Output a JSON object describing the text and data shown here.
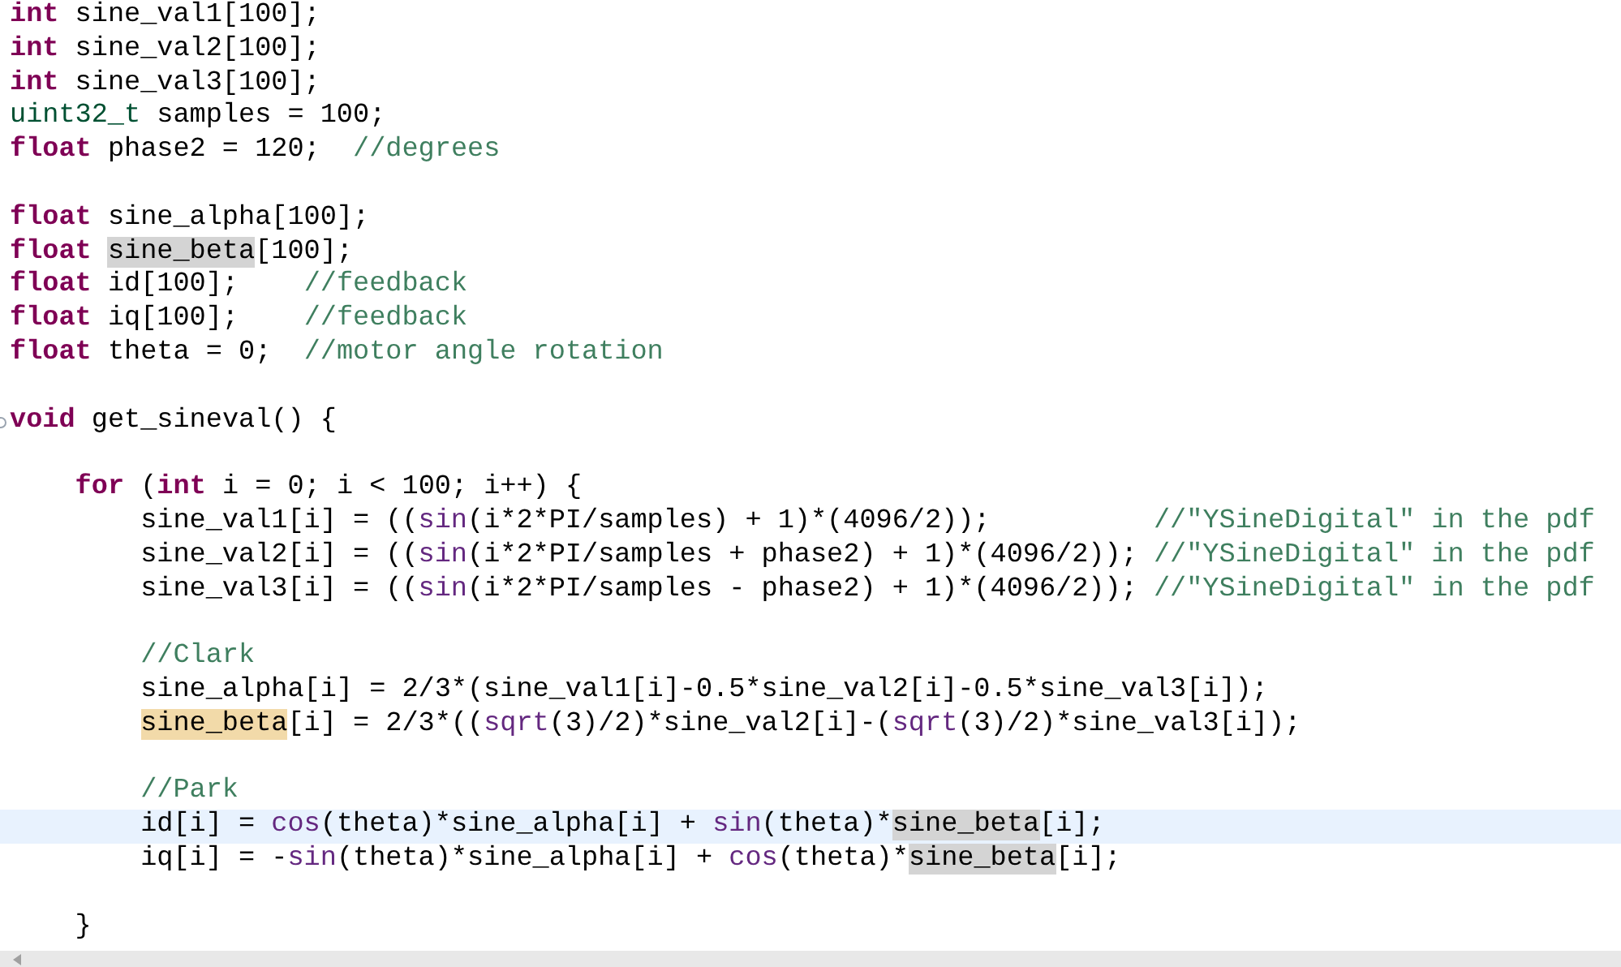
{
  "editor": {
    "lines": [
      {
        "kind": "code",
        "current": false,
        "tokens": [
          {
            "kind": "keyword",
            "text": "int"
          },
          {
            "kind": "plain",
            "text": " sine_val1[100];"
          }
        ]
      },
      {
        "kind": "code",
        "current": false,
        "tokens": [
          {
            "kind": "keyword",
            "text": "int"
          },
          {
            "kind": "plain",
            "text": " sine_val2[100];"
          }
        ]
      },
      {
        "kind": "code",
        "current": false,
        "tokens": [
          {
            "kind": "keyword",
            "text": "int"
          },
          {
            "kind": "plain",
            "text": " sine_val3[100];"
          }
        ]
      },
      {
        "kind": "code",
        "current": false,
        "tokens": [
          {
            "kind": "type",
            "text": "uint32_t"
          },
          {
            "kind": "plain",
            "text": " samples = 100;"
          }
        ]
      },
      {
        "kind": "code",
        "current": false,
        "tokens": [
          {
            "kind": "keyword",
            "text": "float"
          },
          {
            "kind": "plain",
            "text": " phase2 = 120;  "
          },
          {
            "kind": "comment",
            "text": "//degrees"
          }
        ]
      },
      {
        "kind": "blank",
        "current": false
      },
      {
        "kind": "code",
        "current": false,
        "tokens": [
          {
            "kind": "keyword",
            "text": "float"
          },
          {
            "kind": "plain",
            "text": " sine_alpha[100];"
          }
        ]
      },
      {
        "kind": "code",
        "current": false,
        "tokens": [
          {
            "kind": "keyword",
            "text": "float"
          },
          {
            "kind": "occurrence",
            "text": " sine_beta"
          },
          {
            "kind": "plain",
            "text": "[100];"
          }
        ]
      },
      {
        "kind": "code",
        "current": false,
        "tokens": [
          {
            "kind": "keyword",
            "text": "float"
          },
          {
            "kind": "plain",
            "text": " id[100];    "
          },
          {
            "kind": "comment",
            "text": "//feedback"
          }
        ]
      },
      {
        "kind": "code",
        "current": false,
        "tokens": [
          {
            "kind": "keyword",
            "text": "float"
          },
          {
            "kind": "plain",
            "text": " iq[100];    "
          },
          {
            "kind": "comment",
            "text": "//feedback"
          }
        ]
      },
      {
        "kind": "code",
        "current": false,
        "tokens": [
          {
            "kind": "keyword",
            "text": "float"
          },
          {
            "kind": "plain",
            "text": " theta = 0;  "
          },
          {
            "kind": "comment",
            "text": "//motor angle rotation"
          }
        ]
      },
      {
        "kind": "blank",
        "current": false
      },
      {
        "kind": "code",
        "current": false,
        "foldable": true,
        "tokens": [
          {
            "kind": "keyword",
            "text": "void"
          },
          {
            "kind": "plain",
            "text": " get_sineval() {"
          }
        ]
      },
      {
        "kind": "blank",
        "current": false
      },
      {
        "kind": "code",
        "current": false,
        "tokens": [
          {
            "kind": "keyword",
            "text": "    for"
          },
          {
            "kind": "plain",
            "text": " ("
          },
          {
            "kind": "keyword",
            "text": "int"
          },
          {
            "kind": "plain",
            "text": " i = 0; i < 100; i++) {"
          }
        ]
      },
      {
        "kind": "code",
        "current": false,
        "tokens": [
          {
            "kind": "plain",
            "text": "        sine_val1[i] = (("
          },
          {
            "kind": "function",
            "text": "sin"
          },
          {
            "kind": "plain",
            "text": "(i*2*PI/samples) + 1)*(4096/2));          "
          },
          {
            "kind": "comment",
            "text": "//\"YSineDigital\" in the pdf"
          }
        ]
      },
      {
        "kind": "code",
        "current": false,
        "tokens": [
          {
            "kind": "plain",
            "text": "        sine_val2[i] = (("
          },
          {
            "kind": "function",
            "text": "sin"
          },
          {
            "kind": "plain",
            "text": "(i*2*PI/samples + phase2) + 1)*(4096/2)); "
          },
          {
            "kind": "comment",
            "text": "//\"YSineDigital\" in the pdf"
          }
        ]
      },
      {
        "kind": "code",
        "current": false,
        "tokens": [
          {
            "kind": "plain",
            "text": "        sine_val3[i] = (("
          },
          {
            "kind": "function",
            "text": "sin"
          },
          {
            "kind": "plain",
            "text": "(i*2*PI/samples - phase2) + 1)*(4096/2)); "
          },
          {
            "kind": "comment",
            "text": "//\"YSineDigital\" in the pdf"
          }
        ]
      },
      {
        "kind": "blank",
        "current": false
      },
      {
        "kind": "code",
        "current": false,
        "tokens": [
          {
            "kind": "comment",
            "text": "        //Clark"
          }
        ]
      },
      {
        "kind": "code",
        "current": false,
        "tokens": [
          {
            "kind": "plain",
            "text": "        sine_alpha[i] = 2/3*(sine_val1[i]-0.5*sine_val2[i]-0.5*sine_val3[i]);"
          }
        ]
      },
      {
        "kind": "code",
        "current": false,
        "tokens": [
          {
            "kind": "write-occurrence",
            "text": "        sine_beta"
          },
          {
            "kind": "plain",
            "text": "[i] = 2/3*(("
          },
          {
            "kind": "function",
            "text": "sqrt"
          },
          {
            "kind": "plain",
            "text": "(3)/2)*sine_val2[i]-("
          },
          {
            "kind": "function",
            "text": "sqrt"
          },
          {
            "kind": "plain",
            "text": "(3)/2)*sine_val3[i]);"
          }
        ]
      },
      {
        "kind": "blank",
        "current": false
      },
      {
        "kind": "code",
        "current": false,
        "tokens": [
          {
            "kind": "comment",
            "text": "        //Park"
          }
        ]
      },
      {
        "kind": "code",
        "current": true,
        "tokens": [
          {
            "kind": "plain",
            "text": "        id[i] = "
          },
          {
            "kind": "function",
            "text": "cos"
          },
          {
            "kind": "plain",
            "text": "(theta)*sine_alpha[i] + "
          },
          {
            "kind": "function",
            "text": "sin"
          },
          {
            "kind": "plain",
            "text": "(theta)*"
          },
          {
            "kind": "occurrence",
            "text": "sine_beta"
          },
          {
            "kind": "plain",
            "text": "[i];"
          }
        ]
      },
      {
        "kind": "code",
        "current": false,
        "tokens": [
          {
            "kind": "plain",
            "text": "        iq[i] = -"
          },
          {
            "kind": "function",
            "text": "sin"
          },
          {
            "kind": "plain",
            "text": "(theta)*sine_alpha[i] + "
          },
          {
            "kind": "function",
            "text": "cos"
          },
          {
            "kind": "plain",
            "text": "(theta)*"
          },
          {
            "kind": "occurrence",
            "text": "sine_beta"
          },
          {
            "kind": "plain",
            "text": "[i];"
          }
        ]
      },
      {
        "kind": "blank",
        "current": false
      },
      {
        "kind": "code",
        "current": false,
        "tokens": [
          {
            "kind": "plain",
            "text": "    }"
          }
        ]
      }
    ]
  }
}
